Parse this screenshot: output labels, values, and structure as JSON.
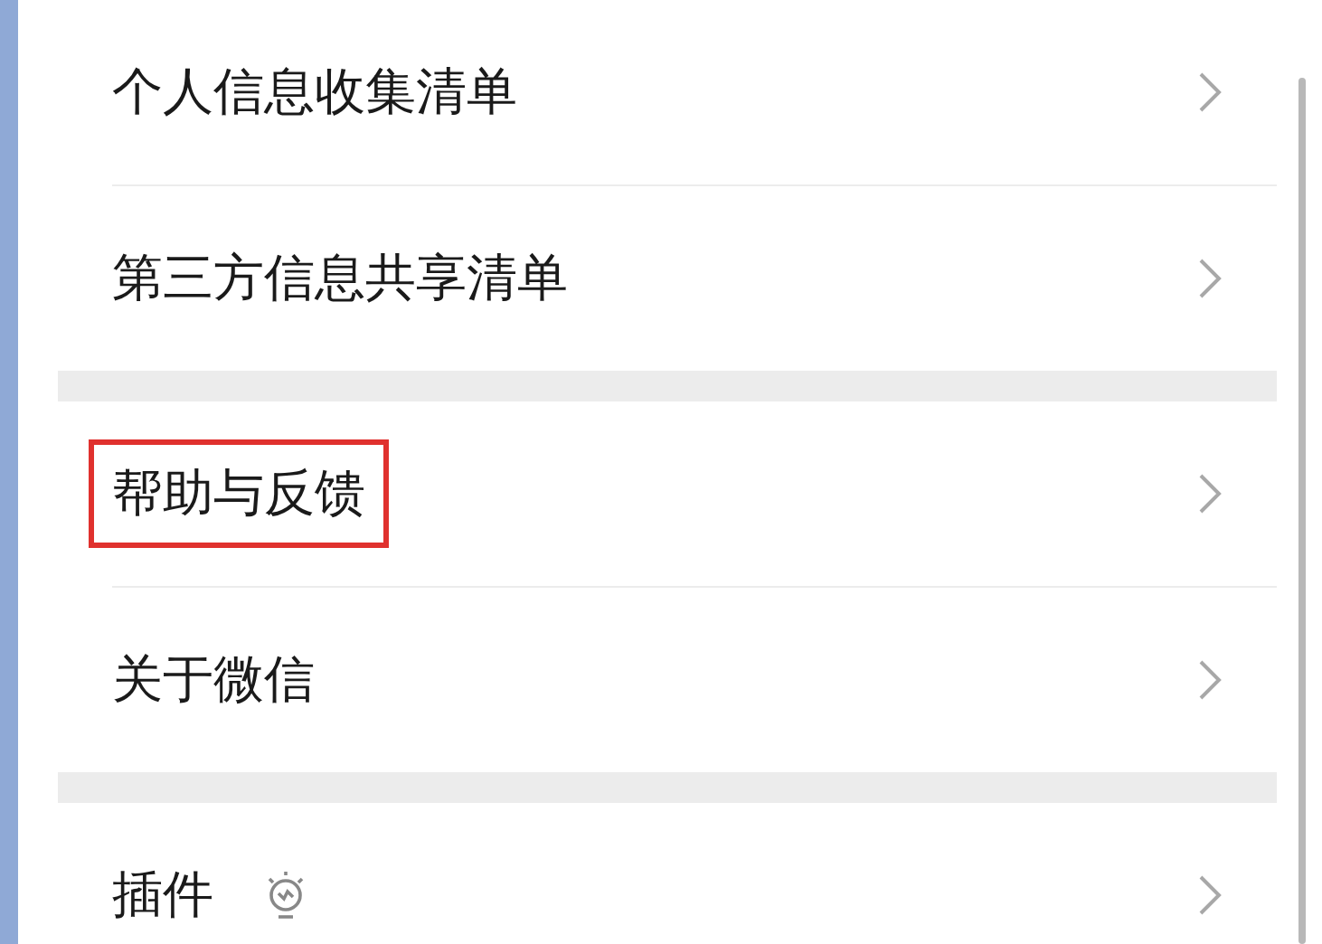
{
  "groups": [
    {
      "items": [
        {
          "label": "个人信息收集清单",
          "kind": "plain",
          "highlighted": false
        },
        {
          "label": "第三方信息共享清单",
          "kind": "plain",
          "highlighted": false
        }
      ]
    },
    {
      "items": [
        {
          "label": "帮助与反馈",
          "kind": "plain",
          "highlighted": true
        },
        {
          "label": "关于微信",
          "kind": "plain",
          "highlighted": false
        }
      ]
    },
    {
      "items": [
        {
          "label": "插件",
          "kind": "with-bulb",
          "highlighted": false
        }
      ]
    }
  ]
}
